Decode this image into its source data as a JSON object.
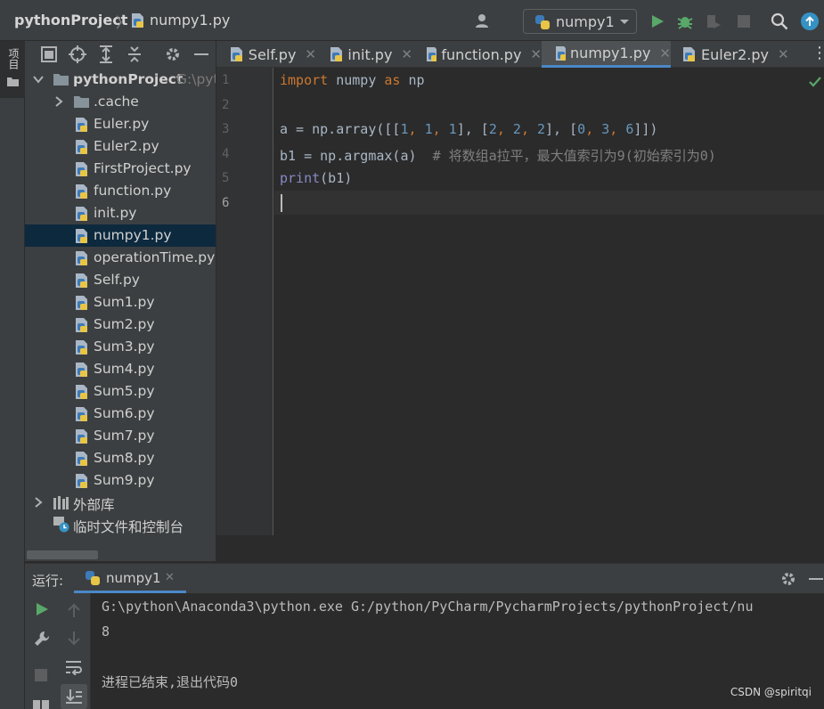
{
  "navbar": {
    "project": "pythonProject",
    "file": "numpy1.py",
    "run_config": "numpy1"
  },
  "toolstrip": {
    "project_label": "项目"
  },
  "project_tree": {
    "root": {
      "label": "pythonProject",
      "hint": "G:\\pyt"
    },
    "items": [
      {
        "label": ".cache",
        "type": "folder"
      },
      {
        "label": "Euler.py",
        "type": "py"
      },
      {
        "label": "Euler2.py",
        "type": "py"
      },
      {
        "label": "FirstProject.py",
        "type": "py"
      },
      {
        "label": "function.py",
        "type": "py"
      },
      {
        "label": "init.py",
        "type": "py"
      },
      {
        "label": "numpy1.py",
        "type": "py",
        "selected": true
      },
      {
        "label": "operationTime.py",
        "type": "py"
      },
      {
        "label": "Self.py",
        "type": "py"
      },
      {
        "label": "Sum1.py",
        "type": "py"
      },
      {
        "label": "Sum2.py",
        "type": "py"
      },
      {
        "label": "Sum3.py",
        "type": "py"
      },
      {
        "label": "Sum4.py",
        "type": "py"
      },
      {
        "label": "Sum5.py",
        "type": "py"
      },
      {
        "label": "Sum6.py",
        "type": "py"
      },
      {
        "label": "Sum7.py",
        "type": "py"
      },
      {
        "label": "Sum8.py",
        "type": "py"
      },
      {
        "label": "Sum9.py",
        "type": "py"
      }
    ],
    "external_libs": "外部库",
    "scratches": "临时文件和控制台"
  },
  "tabs": [
    {
      "label": "Self.py"
    },
    {
      "label": "init.py"
    },
    {
      "label": "function.py"
    },
    {
      "label": "numpy1.py",
      "active": true
    },
    {
      "label": "Euler2.py"
    }
  ],
  "editor": {
    "line_numbers": [
      "1",
      "2",
      "3",
      "4",
      "5",
      "6"
    ],
    "line1": {
      "kw1": "import",
      "mod": " numpy ",
      "kw2": "as",
      "alias": " np"
    },
    "line3": {
      "p1": "a = np.array([[",
      "n1": "1",
      "c1": ", ",
      "n2": "1",
      "c2": ", ",
      "n3": "1",
      "p2": "], [",
      "n4": "2",
      "c3": ", ",
      "n5": "2",
      "c4": ", ",
      "n6": "2",
      "p3": "], [",
      "n7": "0",
      "c5": ", ",
      "n8": "3",
      "c6": ", ",
      "n9": "6",
      "p4": "]])"
    },
    "line4": {
      "code": "b1 = np.argmax(a)  ",
      "comment": "# 将数组a拉平，最大值索引为9(初始索引为0)"
    },
    "line5": {
      "fn": "print",
      "rest": "(b1)"
    }
  },
  "run": {
    "label": "运行:",
    "tab": "numpy1",
    "output": [
      "G:\\python\\Anaconda3\\python.exe G:/python/PyCharm/PycharmProjects/pythonProject/nu",
      "8",
      "",
      "进程已结束,退出代码0"
    ]
  },
  "watermark": "CSDN @spiritqi",
  "colors": {
    "keyword": "#cc7832",
    "number": "#6897bb",
    "comment": "#808080",
    "builtin": "#8888c6",
    "accent": "#4a88c7",
    "run_green": "#59a869"
  }
}
